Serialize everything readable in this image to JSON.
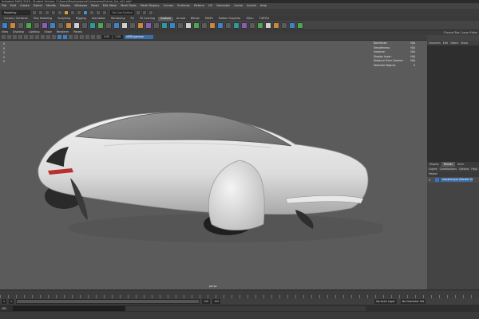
{
  "window": {
    "title": "Autodesk MAYA 2018 - Student Version: C:\\Users\\Maya\\projects\\Car\\scenes\\Future_Car_v01.mb*"
  },
  "menubar": {
    "items": [
      "File",
      "Edit",
      "Create",
      "Select",
      "Modify",
      "Display",
      "Windows",
      "Mesh",
      "Edit Mesh",
      "Mesh Tools",
      "Mesh Display",
      "Curves",
      "Surfaces",
      "Deform",
      "UV",
      "Generate",
      "Cache",
      "Arnold",
      "Help"
    ]
  },
  "statusline": {
    "mode": "Modeling",
    "search_placeholder": "No Live Surface"
  },
  "shelf": {
    "tabs": [
      "Curves / Surfaces",
      "Poly Modeling",
      "Sculpting",
      "Rigging",
      "Animation",
      "Rendering",
      "FX",
      "FX Caching",
      "Custom",
      "Arnold",
      "Bifrost",
      "MASH",
      "Motion Graphics",
      "XGen",
      "TURTLE"
    ],
    "active": "Custom"
  },
  "viewport": {
    "menu": [
      "View",
      "Shading",
      "Lighting",
      "Show",
      "Renderer",
      "Panels"
    ],
    "field_a": "0.00",
    "field_b": "1.00",
    "color_space": "sRGB gamma",
    "hud_left": [
      "0",
      "0",
      "0",
      "0",
      "0",
      "0"
    ],
    "hud_right": [
      {
        "label": "Backfaces:",
        "value": "N/A"
      },
      {
        "label": "Smoothness:",
        "value": "N/A"
      },
      {
        "label": "Instance:",
        "value": "N/A"
      },
      {
        "label": "Display Layer:",
        "value": "N/A"
      },
      {
        "label": "Distance From Camera:",
        "value": "N/A"
      },
      {
        "label": "Selected Objects:",
        "value": "0"
      }
    ],
    "camera_label": "persp"
  },
  "right_panel": {
    "header": "Channel Box / Layer Editor",
    "menu": [
      "Channels",
      "Edit",
      "Object",
      "Show"
    ],
    "layer_tabs": [
      "Display",
      "Render",
      "Anim"
    ],
    "layer_menu": [
      "Layers",
      "Contributions",
      "Options",
      "Help"
    ],
    "layer_bar_label": "Master",
    "layer_row": {
      "visibility": "V",
      "name": "masterLayer (Render Setup)"
    }
  },
  "timeslider": {
    "start": "1",
    "end": "120",
    "range_start": "1",
    "range_end": "120",
    "current": "120",
    "anim_layer": "No Anim Layer",
    "char_set": "No Character Set"
  },
  "cmdline": {
    "tag": "MEL"
  },
  "colors": {
    "accent": "#3a6ea8",
    "viewport_bg": "#5b5b5b",
    "panel_bg": "#444444",
    "highlight": "#d9a43a"
  }
}
